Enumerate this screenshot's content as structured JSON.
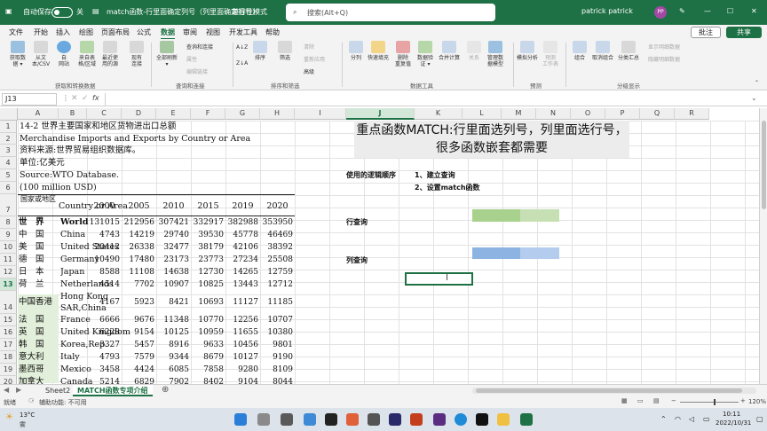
{
  "titlebar": {
    "autosave_label": "自动保存",
    "toggle_state": "关",
    "doc_title": "match函数-行里面确定列号（列里面确定行号）",
    "compat_mode": "兼容性模式",
    "search_placeholder": "搜索(Alt+Q)",
    "user_name": "patrick patrick",
    "avatar_initials": "PP"
  },
  "menu_tabs": [
    "文件",
    "开始",
    "插入",
    "绘图",
    "页面布局",
    "公式",
    "数据",
    "审阅",
    "视图",
    "开发工具",
    "帮助"
  ],
  "active_tab": "数据",
  "comment_label": "批注",
  "share_label": "共享",
  "ribbon": {
    "get_data": [
      {
        "label1": "获取数",
        "label2": "据 ▾"
      },
      {
        "label1": "从文",
        "label2": "本/CSV"
      },
      {
        "label1": "自",
        "label2": "网站"
      },
      {
        "label1": "来自表",
        "label2": "格/区域"
      },
      {
        "label1": "最近使",
        "label2": "用的源"
      },
      {
        "label1": "现有",
        "label2": "连接"
      }
    ],
    "group_get_data": "获取和转换数据",
    "refresh": {
      "label1": "全部刷新",
      "label2": "▾"
    },
    "query_small": [
      "查询和连接",
      "属性",
      "编辑链接"
    ],
    "group_queries": "查询和连接",
    "sort_az": "A↓Z",
    "sort_za": "Z↓A",
    "sort": "排序",
    "filter": "筛选",
    "filter_small": [
      "清除",
      "重新应用",
      "高级"
    ],
    "group_sort_filter": "排序和筛选",
    "tools": [
      "分列",
      "快速填充",
      "删除\n重复值",
      "数据验\n证 ▾",
      "合并计算",
      "关系",
      "管理数\n据模型"
    ],
    "group_tools": "数据工具",
    "whatif": "模拟分析",
    "forecast": "预测\n工作表",
    "group_forecast": "预测",
    "outline": [
      "组合",
      "取消组合",
      "分类汇总"
    ],
    "outline_small": [
      "显示明细数据",
      "隐藏明细数据"
    ],
    "group_outline": "分级显示"
  },
  "formula_bar": {
    "name_box": "J13",
    "fx": "fx"
  },
  "columns": [
    "A",
    "B",
    "C",
    "D",
    "E",
    "F",
    "G",
    "H",
    "I",
    "J",
    "K",
    "L",
    "M",
    "N",
    "O",
    "P",
    "Q",
    "R"
  ],
  "rows": [
    "1",
    "2",
    "3",
    "4",
    "5",
    "6",
    "7",
    "8",
    "9",
    "10",
    "11",
    "12",
    "13",
    "14",
    "15",
    "16",
    "17",
    "18",
    "19",
    "20"
  ],
  "sheet": {
    "header_lines": [
      "14-2 世界主要国家和地区货物进出口总额",
      "Merchandise Imports and Exports by Country or Area",
      "资料来源:世界贸易组织数据库。",
      "单位:亿美元",
      " Source:WTO Database.",
      "(100 million USD)"
    ],
    "table_header": {
      "cn": "国家或地区",
      "en": "Country or Area",
      "years": [
        "2000",
        "2005",
        "2010",
        "2015",
        "2019",
        "2020"
      ]
    },
    "data_rows": [
      {
        "cn": "世　界",
        "en": "World",
        "v": [
          "131015",
          "212956",
          "307421",
          "332917",
          "382988",
          "353950"
        ]
      },
      {
        "cn": "中　国",
        "en": "China",
        "v": [
          "4743",
          "14219",
          "29740",
          "39530",
          "45778",
          "46469"
        ]
      },
      {
        "cn": "美　国",
        "en": "United States",
        "v": [
          "20412",
          "26338",
          "32477",
          "38179",
          "42106",
          "38392"
        ]
      },
      {
        "cn": "德　国",
        "en": "Germany",
        "v": [
          "10490",
          "17480",
          "23173",
          "23773",
          "27234",
          "25508"
        ]
      },
      {
        "cn": "日　本",
        "en": "Japan",
        "v": [
          "8588",
          "11108",
          "14638",
          "12730",
          "14265",
          "12759"
        ]
      },
      {
        "cn": "荷　兰",
        "en": "Netherlands",
        "v": [
          "4514",
          "7702",
          "10907",
          "10825",
          "13443",
          "12712"
        ]
      },
      {
        "cn": "中国香港",
        "en": "Hong Kong",
        "en2": "SAR,China",
        "v": [
          "4167",
          "5923",
          "8421",
          "10693",
          "11127",
          "11185"
        ]
      },
      {
        "cn": "法　国",
        "en": "France",
        "v": [
          "6666",
          "9676",
          "11348",
          "10770",
          "12256",
          "10707"
        ]
      },
      {
        "cn": "英　国",
        "en": "United Kingdom",
        "v": [
          "6228",
          "9154",
          "10125",
          "10959",
          "11655",
          "10380"
        ]
      },
      {
        "cn": "韩　国",
        "en": "Korea,Rep.",
        "v": [
          "3327",
          "5457",
          "8916",
          "9633",
          "10456",
          "9801"
        ]
      },
      {
        "cn": "意大利",
        "en": "Italy",
        "v": [
          "4793",
          "7579",
          "9344",
          "8679",
          "10127",
          "9190"
        ]
      },
      {
        "cn": "墨西哥",
        "en": "Mexico",
        "v": [
          "3458",
          "4424",
          "6085",
          "7858",
          "9280",
          "8109"
        ]
      },
      {
        "cn": "加拿大",
        "en": "Canada",
        "v": [
          "5214",
          "6829",
          "7902",
          "8402",
          "9104",
          "8044"
        ]
      }
    ],
    "title_box": "重点函数MATCH:行里面选列号，列里面选行号，很多函数嵌套都需要",
    "logic_label": "使用的逻辑顺序",
    "step1": "1、建立查询",
    "step2": "2、设置match函数",
    "row_query": "行查询",
    "col_query": "列查询"
  },
  "sheet_tabs": [
    "Sheet2",
    "MATCH函数专项介绍"
  ],
  "active_sheet": "MATCH函数专项介绍",
  "status": {
    "ready": "就绪",
    "accessibility": "辅助功能: 不可用",
    "zoom": "120%"
  },
  "taskbar": {
    "temp": "13°C",
    "weather": "雾",
    "time": "10:11",
    "date": "2022/10/31"
  },
  "colors": {
    "excel_green": "#1e7145",
    "light_green_fill": "#a9d18e",
    "blue_fill": "#8db3e2",
    "title_box_bg": "#ececec"
  }
}
